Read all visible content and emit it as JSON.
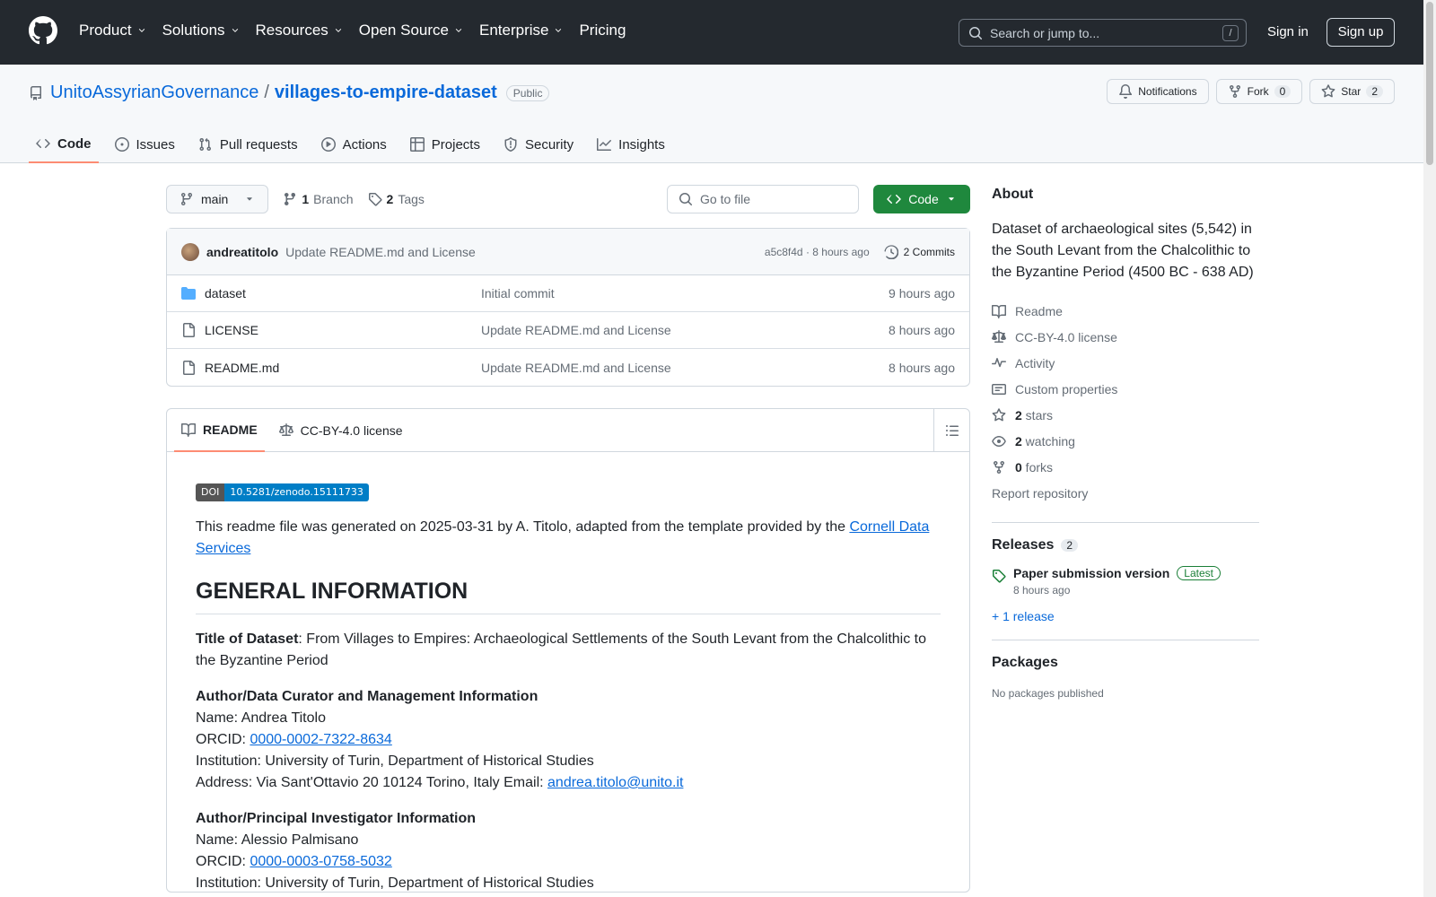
{
  "header": {
    "nav": [
      {
        "label": "Product",
        "chevron": true
      },
      {
        "label": "Solutions",
        "chevron": true
      },
      {
        "label": "Resources",
        "chevron": true
      },
      {
        "label": "Open Source",
        "chevron": true
      },
      {
        "label": "Enterprise",
        "chevron": true
      },
      {
        "label": "Pricing",
        "chevron": false
      }
    ],
    "search_placeholder": "Search or jump to...",
    "search_shortcut": "/",
    "signin": "Sign in",
    "signup": "Sign up"
  },
  "repo": {
    "owner": "UnitoAssyrianGovernance",
    "separator": "/",
    "name": "villages-to-empire-dataset",
    "visibility": "Public",
    "notifications": "Notifications",
    "fork_label": "Fork",
    "fork_count": "0",
    "star_label": "Star",
    "star_count": "2",
    "tabs": [
      {
        "label": "Code",
        "icon": "code-icon",
        "active": true
      },
      {
        "label": "Issues",
        "icon": "issue-icon",
        "active": false
      },
      {
        "label": "Pull requests",
        "icon": "pull-request-icon",
        "active": false
      },
      {
        "label": "Actions",
        "icon": "play-icon",
        "active": false
      },
      {
        "label": "Projects",
        "icon": "table-icon",
        "active": false
      },
      {
        "label": "Security",
        "icon": "shield-icon",
        "active": false
      },
      {
        "label": "Insights",
        "icon": "graph-icon",
        "active": false
      }
    ]
  },
  "toolbar": {
    "branch": "main",
    "branch_count": "1",
    "branch_label": "Branch",
    "tag_count": "2",
    "tag_label": "Tags",
    "gofile_placeholder": "Go to file",
    "code_button": "Code"
  },
  "commit": {
    "author": "andreatitolo",
    "message": "Update README.md and License",
    "hash_time": "a5c8f4d · 8 hours ago",
    "commits": "2 Commits"
  },
  "files": [
    {
      "name": "dataset",
      "type": "folder",
      "message": "Initial commit",
      "age": "9 hours ago"
    },
    {
      "name": "LICENSE",
      "type": "file",
      "message": "Update README.md and License",
      "age": "8 hours ago"
    },
    {
      "name": "README.md",
      "type": "file",
      "message": "Update README.md and License",
      "age": "8 hours ago"
    }
  ],
  "readme": {
    "tab_readme": "README",
    "tab_license": "CC-BY-4.0 license",
    "doi_label": "DOI",
    "doi_value": "10.5281/zenodo.15111733",
    "intro": "This readme file was generated on 2025-03-31 by A. Titolo, adapted from the template provided by the ",
    "intro_link": "Cornell Data Services",
    "h1": "GENERAL INFORMATION",
    "title_label": "Title of Dataset",
    "title_value": ": From Villages to Empires: Archaeological Settlements of the South Levant from the Chalcolithic to the Byzantine Period",
    "curator_heading": "Author/Data Curator and Management Information",
    "curator_name": "Name: Andrea Titolo",
    "curator_orcid_label": "ORCID: ",
    "curator_orcid": "0000-0002-7322-8634",
    "curator_inst": "Institution: University of Turin, Department of Historical Studies",
    "curator_address": "Address: Via Sant'Ottavio 20 10124 Torino, Italy Email: ",
    "curator_email": "andrea.titolo@unito.it",
    "pi_heading": "Author/Principal Investigator Information",
    "pi_name": "Name: Alessio Palmisano",
    "pi_orcid_label": "ORCID: ",
    "pi_orcid": "0000-0003-0758-5032",
    "pi_inst": "Institution: University of Turin, Department of Historical Studies"
  },
  "about": {
    "heading": "About",
    "description": "Dataset of archaeological sites (5,542) in the South Levant from the Chalcolithic to the Byzantine Period (4500 BC - 638 AD)",
    "items": [
      {
        "icon": "book-icon",
        "bold": "",
        "label": "Readme"
      },
      {
        "icon": "law-icon",
        "bold": "",
        "label": "CC-BY-4.0 license"
      },
      {
        "icon": "pulse-icon",
        "bold": "",
        "label": "Activity"
      },
      {
        "icon": "note-icon",
        "bold": "",
        "label": "Custom properties"
      },
      {
        "icon": "star-icon",
        "bold": "2",
        "label": " stars"
      },
      {
        "icon": "eye-icon",
        "bold": "2",
        "label": " watching"
      },
      {
        "icon": "fork-icon",
        "bold": "0",
        "label": " forks"
      }
    ],
    "report": "Report repository",
    "releases_heading": "Releases",
    "releases_count": "2",
    "release_name": "Paper submission version",
    "release_badge": "Latest",
    "release_time": "8 hours ago",
    "more_releases": "+ 1 release",
    "packages_heading": "Packages",
    "packages_empty": "No packages published"
  }
}
